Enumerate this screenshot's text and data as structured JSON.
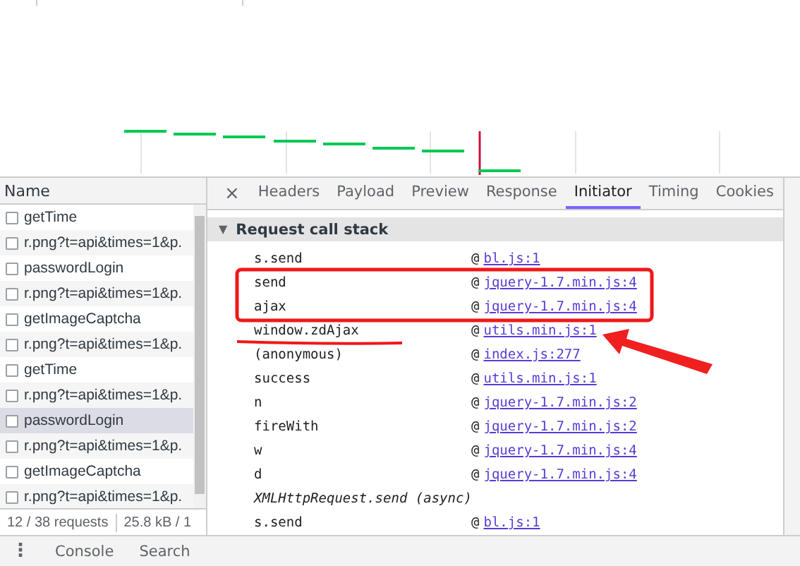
{
  "requests": {
    "column_header": "Name",
    "rows": [
      {
        "name": "getTime",
        "checked": false,
        "selected": false
      },
      {
        "name": "r.png?t=api&times=1&p.",
        "checked": false,
        "selected": false
      },
      {
        "name": "passwordLogin",
        "checked": false,
        "selected": false
      },
      {
        "name": "r.png?t=api&times=1&p.",
        "checked": false,
        "selected": false
      },
      {
        "name": "getImageCaptcha",
        "checked": false,
        "selected": false
      },
      {
        "name": "r.png?t=api&times=1&p.",
        "checked": false,
        "selected": false
      },
      {
        "name": "getTime",
        "checked": false,
        "selected": false
      },
      {
        "name": "r.png?t=api&times=1&p.",
        "checked": false,
        "selected": false
      },
      {
        "name": "passwordLogin",
        "checked": false,
        "selected": true
      },
      {
        "name": "r.png?t=api&times=1&p.",
        "checked": false,
        "selected": false
      },
      {
        "name": "getImageCaptcha",
        "checked": false,
        "selected": false
      },
      {
        "name": "r.png?t=api&times=1&p.",
        "checked": false,
        "selected": false
      }
    ],
    "status": {
      "count": "12 / 38 requests",
      "size": "25.8 kB / 1"
    }
  },
  "detail": {
    "close": "×",
    "tabs": [
      {
        "label": "Headers",
        "selected": false
      },
      {
        "label": "Payload",
        "selected": false
      },
      {
        "label": "Preview",
        "selected": false
      },
      {
        "label": "Response",
        "selected": false
      },
      {
        "label": "Initiator",
        "selected": true
      },
      {
        "label": "Timing",
        "selected": false
      },
      {
        "label": "Cookies",
        "selected": false
      }
    ],
    "section": {
      "toggle": "▼",
      "title": "Request call stack",
      "expanded": true
    },
    "frames": [
      {
        "kind": "frame",
        "function": "s.send",
        "at": "@",
        "source": "bl.js:1"
      },
      {
        "kind": "frame",
        "function": "send",
        "at": "@",
        "source": "jquery-1.7.min.js:4"
      },
      {
        "kind": "frame",
        "function": "ajax",
        "at": "@",
        "source": "jquery-1.7.min.js:4"
      },
      {
        "kind": "frame",
        "function": "window.zdAjax",
        "at": "@",
        "source": "utils.min.js:1"
      },
      {
        "kind": "frame",
        "function": "(anonymous)",
        "at": "@",
        "source": "index.js:277"
      },
      {
        "kind": "frame",
        "function": "success",
        "at": "@",
        "source": "utils.min.js:1"
      },
      {
        "kind": "frame",
        "function": "n",
        "at": "@",
        "source": "jquery-1.7.min.js:2"
      },
      {
        "kind": "frame",
        "function": "fireWith",
        "at": "@",
        "source": "jquery-1.7.min.js:2"
      },
      {
        "kind": "frame",
        "function": "w",
        "at": "@",
        "source": "jquery-1.7.min.js:4"
      },
      {
        "kind": "frame",
        "function": "d",
        "at": "@",
        "source": "jquery-1.7.min.js:4"
      },
      {
        "kind": "async",
        "function": "XMLHttpRequest.send (async)"
      },
      {
        "kind": "frame",
        "function": "s.send",
        "at": "@",
        "source": "bl.js:1"
      }
    ]
  },
  "drawer": {
    "menu": "⋮",
    "tabs": [
      "Console",
      "Search"
    ]
  }
}
